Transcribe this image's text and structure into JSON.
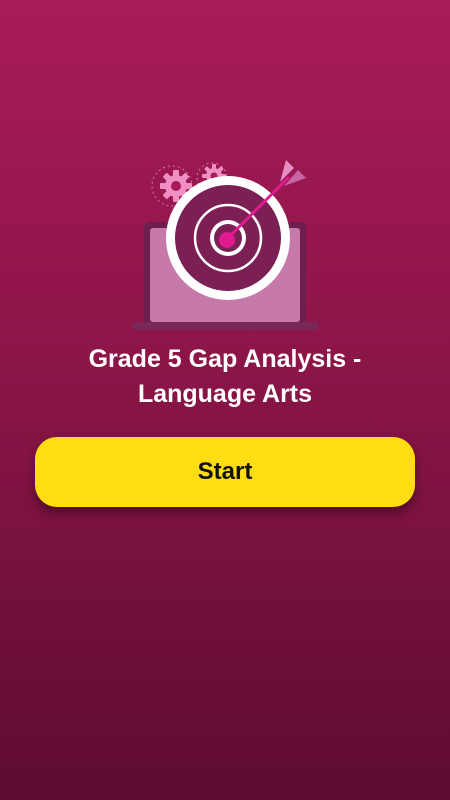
{
  "title_line1": "Grade 5 Gap Analysis -",
  "title_line2": "Language Arts",
  "start_button_label": "Start",
  "illustration": {
    "icons": [
      "gear-icon",
      "gear-icon",
      "laptop-icon",
      "target-icon",
      "dart-icon"
    ]
  },
  "colors": {
    "background_top": "#a81b58",
    "background_bottom": "#5e0c31",
    "button": "#ffdd12",
    "button_text": "#111111",
    "title_text": "#ffffff"
  }
}
